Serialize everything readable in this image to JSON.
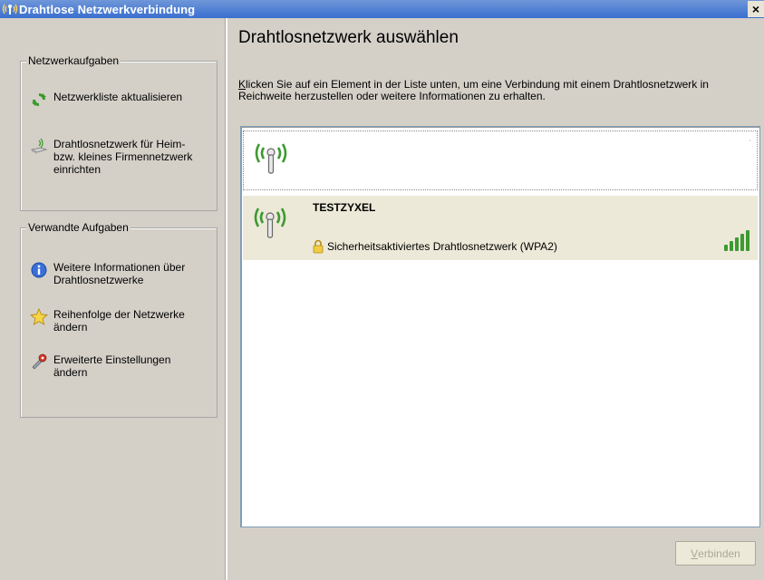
{
  "window": {
    "title": "Drahtlose Netzwerkverbindung",
    "close_label": "×"
  },
  "sidebar": {
    "network_tasks": {
      "legend": "Netzwerkaufgaben",
      "items": [
        {
          "icon": "refresh-icon",
          "label": "Netzwerkliste aktualisieren"
        },
        {
          "icon": "wireless-setup-icon",
          "label": "Drahtlosnetzwerk für Heim- bzw. kleines Firmennetzwerk einrichten"
        }
      ]
    },
    "related_tasks": {
      "legend": "Verwandte Aufgaben",
      "items": [
        {
          "icon": "info-icon",
          "label": "Weitere Informationen über Drahtlosnetzwerke"
        },
        {
          "icon": "star-icon",
          "label": "Reihenfolge der Netzwerke ändern"
        },
        {
          "icon": "settings-icon",
          "label": "Erweiterte Einstellungen ändern"
        }
      ]
    }
  },
  "main": {
    "title": "Drahtlosnetzwerk auswählen",
    "description_first_letter": "K",
    "description_rest": "licken Sie auf ein Element in der Liste unten, um eine Verbindung mit einem Drahtlosnetzwerk in Reichweite herzustellen oder weitere Informationen zu erhalten.",
    "networks": [
      {
        "name": "",
        "security": "",
        "signal_bars": 0
      },
      {
        "name": "TESTZYXEL",
        "security": "Sicherheitsaktiviertes Drahtlosnetzwerk (WPA2)",
        "signal_bars": 5
      }
    ],
    "connect_button_first_letter": "V",
    "connect_button_rest": "erbinden"
  },
  "colors": {
    "titlebar": "#3a6fd0",
    "panel": "#d4d0c8",
    "signal_green": "#3c9a32",
    "selected_row": "#ece9d8"
  }
}
